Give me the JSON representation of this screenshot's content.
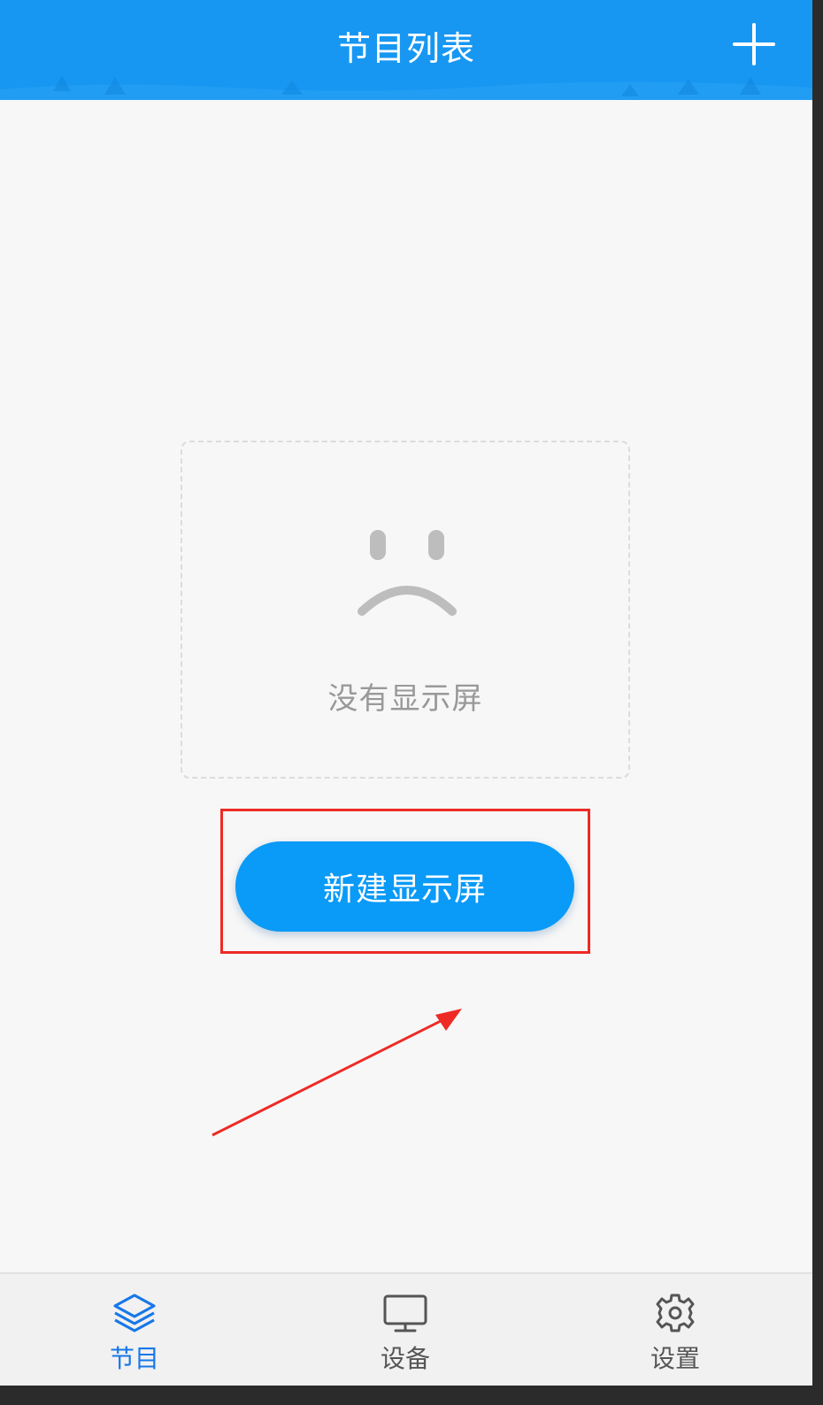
{
  "header": {
    "title": "节目列表",
    "add_icon": "plus-icon"
  },
  "empty_state": {
    "icon": "sad-face-icon",
    "message": "没有显示屏"
  },
  "actions": {
    "create_label": "新建显示屏"
  },
  "tabs": [
    {
      "label": "节目",
      "icon": "layers-icon",
      "active": true
    },
    {
      "label": "设备",
      "icon": "monitor-icon",
      "active": false
    },
    {
      "label": "设置",
      "icon": "gear-icon",
      "active": false
    }
  ],
  "colors": {
    "header_bg": "#1797f2",
    "button_bg": "#0a9af7",
    "active_tab": "#1677e8",
    "annotation": "#ee2a24",
    "page_bg": "#f7f7f7"
  }
}
